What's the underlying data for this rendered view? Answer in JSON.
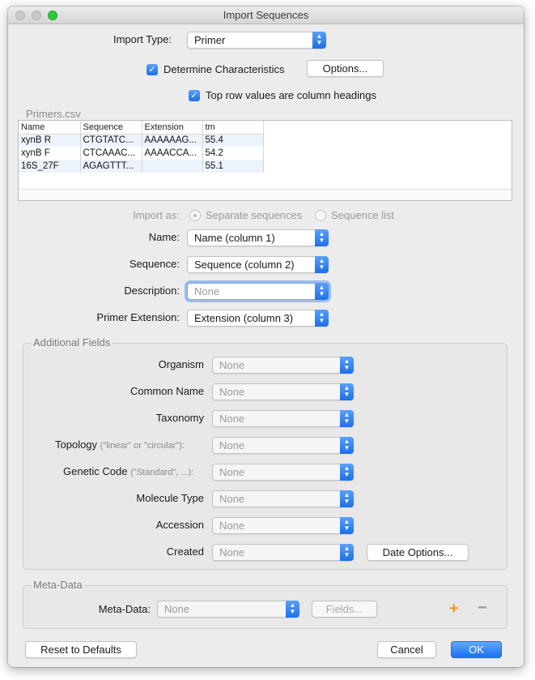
{
  "window": {
    "title": "Import Sequences"
  },
  "import_type": {
    "label": "Import Type:",
    "value": "Primer"
  },
  "determine": {
    "label": "Determine Characteristics",
    "checked": true,
    "options_button": "Options..."
  },
  "top_row": {
    "label": "Top row values are column headings",
    "checked": true
  },
  "file": {
    "name": "Primers.csv"
  },
  "table": {
    "columns": [
      "Name",
      "Sequence",
      "Extension",
      "tm"
    ],
    "rows": [
      [
        "xynB R",
        "CTGTATC...",
        "AAAAAAG...",
        "55.4"
      ],
      [
        "xynB F",
        "CTCAAAC...",
        "AAAACCA...",
        "54.2"
      ],
      [
        "16S_27F",
        "AGAGTTT...",
        "",
        "55.1"
      ]
    ]
  },
  "import_as": {
    "label": "Import as:",
    "option1": "Separate sequences",
    "option2": "Sequence list",
    "selected": "Separate sequences"
  },
  "mapping": {
    "name": {
      "label": "Name:",
      "value": "Name (column 1)"
    },
    "sequence": {
      "label": "Sequence:",
      "value": "Sequence  (column 2)"
    },
    "description": {
      "label": "Description:",
      "value": "None"
    },
    "primer_extension": {
      "label": "Primer Extension:",
      "value": "Extension (column 3)"
    }
  },
  "additional": {
    "title": "Additional Fields",
    "organism": {
      "label": "Organism",
      "value": "None"
    },
    "common_name": {
      "label": "Common Name",
      "value": "None"
    },
    "taxonomy": {
      "label": "Taxonomy",
      "value": "None"
    },
    "topology": {
      "label": "Topology",
      "hint": "(\"linear\" or \"circular\"):",
      "value": "None"
    },
    "genetic_code": {
      "label": "Genetic Code",
      "hint": "(\"Standard\", ...):",
      "value": "None"
    },
    "molecule_type": {
      "label": "Molecule Type",
      "value": "None"
    },
    "accession": {
      "label": "Accession",
      "value": "None"
    },
    "created": {
      "label": "Created",
      "value": "None"
    },
    "date_options_button": "Date Options..."
  },
  "meta": {
    "title": "Meta-Data",
    "label": "Meta-Data:",
    "value": "None",
    "fields_button": "Fields...",
    "add_symbol": "+",
    "remove_symbol": "−"
  },
  "footer": {
    "reset": "Reset to Defaults",
    "cancel": "Cancel",
    "ok": "OK"
  },
  "colors": {
    "accent": "#1d6fe8",
    "add": "#f09a2a"
  }
}
